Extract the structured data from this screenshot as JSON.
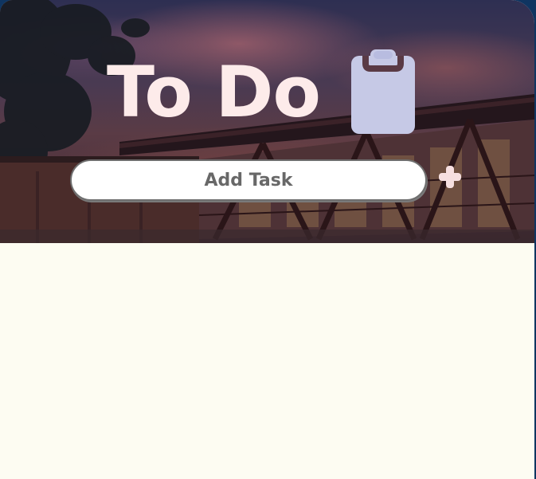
{
  "header": {
    "title": "To Do",
    "title_icon": "clipboard-icon"
  },
  "task_entry": {
    "placeholder": "Add Task",
    "value": "",
    "add_button_icon": "plus-icon"
  },
  "task_list": {
    "items": []
  },
  "colors": {
    "title": "#fdebea",
    "clipboard_fill": "#c6c9e6",
    "clipboard_clip": "#5a3a45",
    "input_background": "#ffffff",
    "input_text": "#686868",
    "plus_icon": "#f6dfe0",
    "list_background": "#fdfcf2",
    "page_background": "#0f3561"
  }
}
